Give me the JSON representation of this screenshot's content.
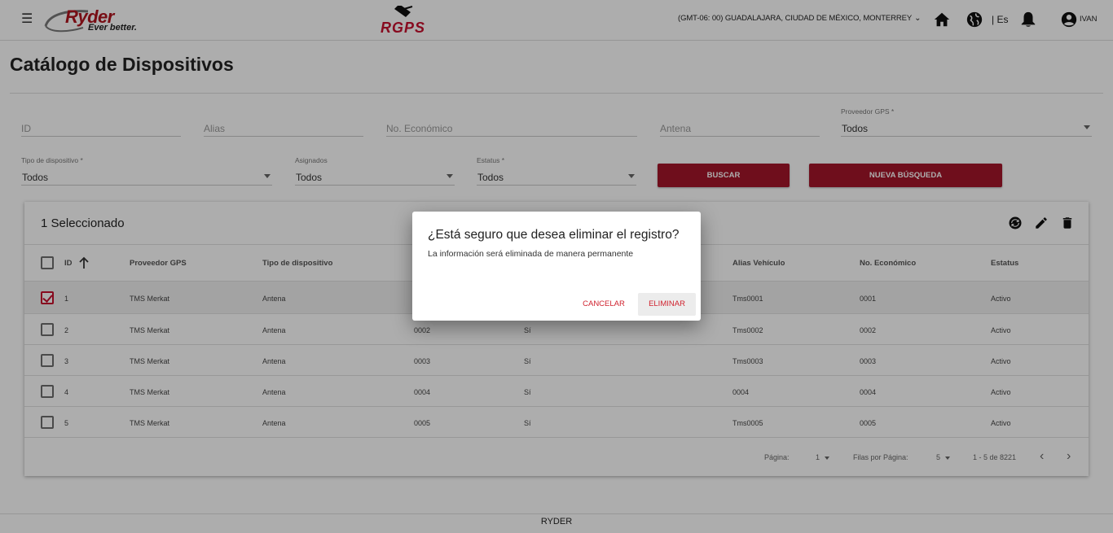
{
  "header": {
    "brand": "Ryder",
    "brand_tagline": "Ever better.",
    "product": "RGPS",
    "timezone": "(GMT-06: 00) GUADALAJARA, CIUDAD DE MÉXICO, MONTERREY",
    "language": "| Es",
    "user": "IVAN",
    "icons": [
      "menu-icon",
      "chevron-down-icon",
      "home-icon",
      "globe-icon",
      "bell-icon",
      "account-icon"
    ]
  },
  "page": {
    "title": "Catálogo de Dispositivos"
  },
  "filters": {
    "id_placeholder": "ID",
    "alias_placeholder": "Alias",
    "economic_placeholder": "No. Económico",
    "antenna_placeholder": "Antena",
    "provider": {
      "label": "Proveedor GPS *",
      "value": "Todos"
    },
    "device_type": {
      "label": "Tipo de dispositivo *",
      "value": "Todos"
    },
    "assigned": {
      "label": "Asignados",
      "value": "Todos"
    },
    "status": {
      "label": "Estatus *",
      "value": "Todos"
    },
    "search_button": "BUSCAR",
    "new_search_button": "NUEVA BÚSQUEDA"
  },
  "table": {
    "selected_label": "1 Seleccionado",
    "actions": [
      "sync-icon",
      "edit-icon",
      "delete-icon"
    ],
    "columns": {
      "id": "ID",
      "provider": "Proveedor GPS",
      "device_type": "Tipo de dispositivo",
      "vehicle_alias": "Alias Vehículo",
      "economic": "No. Económico",
      "status": "Estatus"
    },
    "rows": [
      {
        "checked": true,
        "id": "1",
        "provider": "TMS Merkat",
        "device_type": "Antena",
        "antenna": "",
        "assigned": "",
        "vehicle_alias": "Tms0001",
        "economic": "0001",
        "status": "Activo"
      },
      {
        "checked": false,
        "id": "2",
        "provider": "TMS Merkat",
        "device_type": "Antena",
        "antenna": "0002",
        "assigned": "Sí",
        "vehicle_alias": "Tms0002",
        "economic": "0002",
        "status": "Activo"
      },
      {
        "checked": false,
        "id": "3",
        "provider": "TMS Merkat",
        "device_type": "Antena",
        "antenna": "0003",
        "assigned": "Sí",
        "vehicle_alias": "Tms0003",
        "economic": "0003",
        "status": "Activo"
      },
      {
        "checked": false,
        "id": "4",
        "provider": "TMS Merkat",
        "device_type": "Antena",
        "antenna": "0004",
        "assigned": "Sí",
        "vehicle_alias": "0004",
        "economic": "0004",
        "status": "Activo"
      },
      {
        "checked": false,
        "id": "5",
        "provider": "TMS Merkat",
        "device_type": "Antena",
        "antenna": "0005",
        "assigned": "Sí",
        "vehicle_alias": "Tms0005",
        "economic": "0005",
        "status": "Activo"
      }
    ],
    "pagination": {
      "page_label": "Página:",
      "page_value": "1",
      "rows_label": "Filas por Página:",
      "rows_value": "5",
      "range": "1 - 5 de 8221"
    }
  },
  "footer": {
    "text": "RYDER"
  },
  "dialog": {
    "title": "¿Está seguro que desea eliminar el registro?",
    "message": "La información será eliminada de manera permanente",
    "cancel_label": "CANCELAR",
    "confirm_label": "ELIMINAR"
  }
}
